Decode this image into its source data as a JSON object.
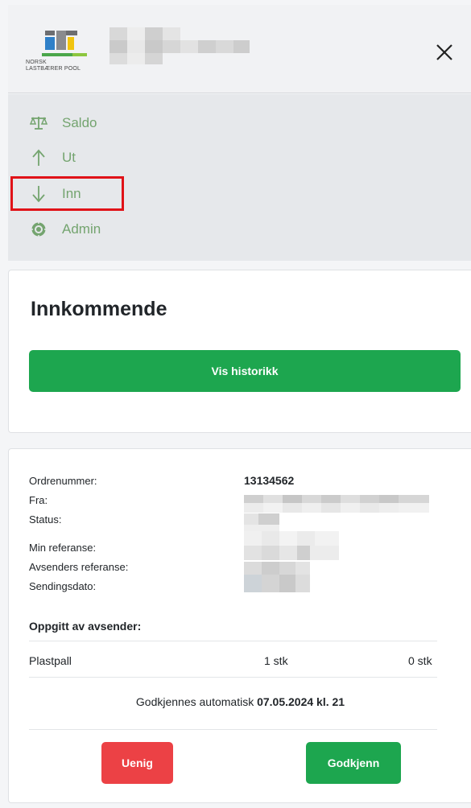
{
  "header": {
    "logo_line1": "NORSK",
    "logo_line2": "LASTBÆRER POOL",
    "close_label": "✕"
  },
  "nav": {
    "items": [
      {
        "label": "Saldo",
        "icon": "scale-icon"
      },
      {
        "label": "Ut",
        "icon": "arrow-up-icon"
      },
      {
        "label": "Inn",
        "icon": "arrow-down-icon"
      },
      {
        "label": "Admin",
        "icon": "gear-icon"
      }
    ],
    "accent_color": "#74a46f"
  },
  "incoming": {
    "title": "Innkommende",
    "history_button": "Vis historikk"
  },
  "order": {
    "labels": {
      "order_number": "Ordrenummer:",
      "from": "Fra:",
      "status": "Status:",
      "my_reference": "Min referanse:",
      "sender_reference": "Avsenders referanse:",
      "send_date": "Sendingsdato:"
    },
    "order_number": "13134562",
    "sender_section_title": "Oppgitt av avsender:",
    "item": {
      "name": "Plastpall",
      "sent": "1 stk",
      "received": "0 stk"
    },
    "auto_approve_prefix": "Godkjennes automatisk ",
    "auto_approve_date": "07.05.2024 kl. 21",
    "disagree_button": "Uenig",
    "approve_button": "Godkjenn"
  },
  "colors": {
    "primary_green": "#1da64f",
    "danger_red": "#ec4145",
    "highlight_red": "#e01218"
  }
}
